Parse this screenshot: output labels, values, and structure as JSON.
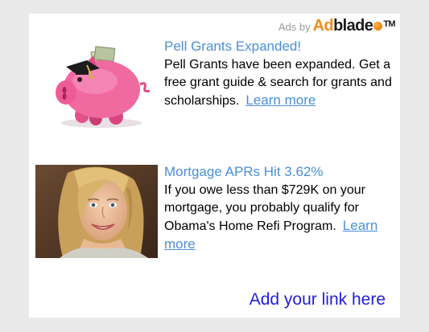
{
  "header": {
    "ads_by_label": "Ads by",
    "logo_text_ad": "Ad",
    "logo_text_blade": "blade",
    "logo_trademark": "TM",
    "logo_icon": "adblade-logo-icon"
  },
  "ads": [
    {
      "image_icon": "piggy-bank-graduation-image",
      "title": "Pell Grants Expanded!",
      "body": "Pell Grants have been expanded. Get a free grant guide & search for grants and scholarships.",
      "cta": "Learn more"
    },
    {
      "image_icon": "smiling-woman-photo",
      "title": "Mortgage APRs Hit 3.62%",
      "body": "If you owe less than $729K on your mortgage, you probably qualify for Obama's Home Refi Program.",
      "cta": "Learn more"
    }
  ],
  "footer": {
    "add_link_label": "Add your link here"
  },
  "colors": {
    "background": "#e9e9e9",
    "panel": "#ffffff",
    "link_blue": "#4a8fd8",
    "add_link_blue": "#1f1fdb",
    "brand_orange": "#f08a1a"
  }
}
